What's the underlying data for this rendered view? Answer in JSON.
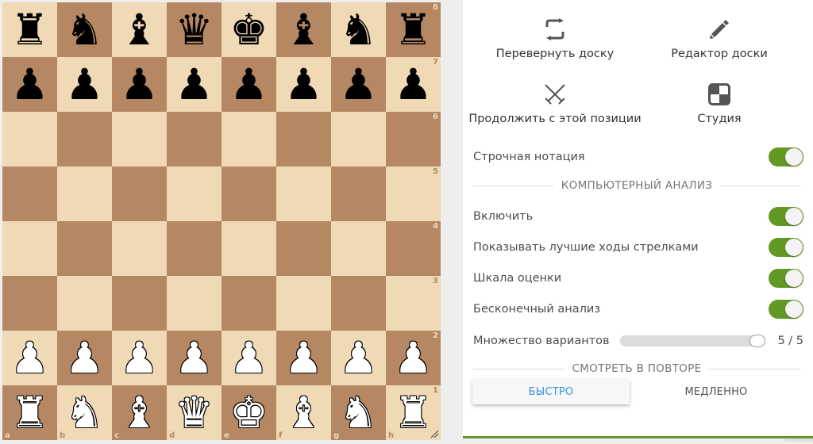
{
  "board": {
    "files": [
      "a",
      "b",
      "c",
      "d",
      "e",
      "f",
      "g",
      "h"
    ],
    "ranks": [
      "8",
      "7",
      "6",
      "5",
      "4",
      "3",
      "2",
      "1"
    ],
    "rows": [
      [
        "br",
        "bn",
        "bb",
        "bq",
        "bk",
        "bb",
        "bn",
        "br"
      ],
      [
        "bp",
        "bp",
        "bp",
        "bp",
        "bp",
        "bp",
        "bp",
        "bp"
      ],
      [
        "",
        "",
        "",
        "",
        "",
        "",
        "",
        ""
      ],
      [
        "",
        "",
        "",
        "",
        "",
        "",
        "",
        ""
      ],
      [
        "",
        "",
        "",
        "",
        "",
        "",
        "",
        ""
      ],
      [
        "",
        "",
        "",
        "",
        "",
        "",
        "",
        ""
      ],
      [
        "wp",
        "wp",
        "wp",
        "wp",
        "wp",
        "wp",
        "wp",
        "wp"
      ],
      [
        "wr",
        "wn",
        "wb",
        "wq",
        "wk",
        "wb",
        "wn",
        "wr"
      ]
    ],
    "colors": {
      "light": "#f0d9b5",
      "dark": "#b58863"
    }
  },
  "tools": {
    "flip": {
      "label": "Перевернуть доску",
      "icon": "flip-board-icon"
    },
    "editor": {
      "label": "Редактор доски",
      "icon": "pencil-icon"
    },
    "continue": {
      "label": "Продолжить с этой позиции",
      "icon": "crossed-swords-icon"
    },
    "study": {
      "label": "Студия",
      "icon": "study-icon"
    }
  },
  "settings": {
    "inline_notation": {
      "label": "Строчная нотация",
      "on": true
    },
    "analysis_header": "КОМПЬЮТЕРНЫЙ АНАЛИЗ",
    "enable": {
      "label": "Включить",
      "on": true
    },
    "best_arrows": {
      "label": "Показывать лучшие ходы стрелками",
      "on": true
    },
    "eval_gauge": {
      "label": "Шкала оценки",
      "on": true
    },
    "infinite": {
      "label": "Бесконечный анализ",
      "on": true
    },
    "multipv": {
      "label": "Множество вариантов",
      "value": "5 / 5",
      "fraction": 1.0
    }
  },
  "replay": {
    "header": "СМОТРЕТЬ В ПОВТОРЕ",
    "fast": "БЫСТРО",
    "slow": "МЕДЛЕННО",
    "selected": "fast"
  },
  "accent_color": "#629924",
  "link_color": "#3692e7"
}
